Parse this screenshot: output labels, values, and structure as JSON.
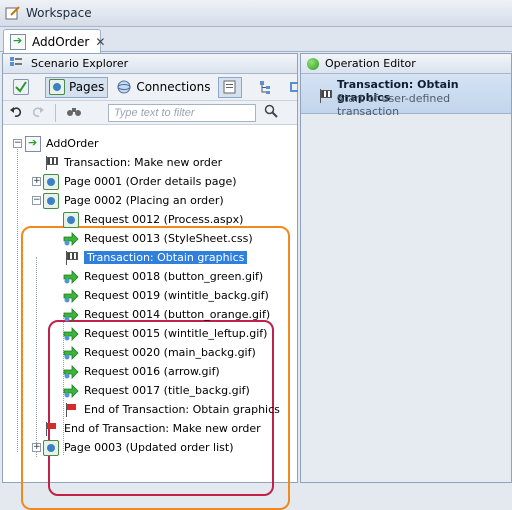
{
  "window": {
    "title": "Workspace"
  },
  "document_tab": {
    "label": "AddOrder",
    "close_glyph": "✕"
  },
  "scenario_explorer": {
    "title": "Scenario Explorer",
    "toolbar": {
      "pages_label": "Pages",
      "connections_label": "Connections"
    },
    "filter": {
      "placeholder": "Type text to filter",
      "value": ""
    }
  },
  "tree": {
    "root": "AddOrder",
    "nodes": [
      {
        "label": "Transaction: Make new order",
        "icon": "transaction-flag-icon"
      },
      {
        "label": "Page 0001 (Order details page)",
        "icon": "page-icon"
      },
      {
        "label": "Page 0002 (Placing an order)",
        "icon": "page-icon"
      },
      {
        "label": "Request 0012 (Process.aspx)",
        "icon": "request-page-icon"
      },
      {
        "label": "Request 0013 (StyleSheet.css)",
        "icon": "request-arrow-icon"
      },
      {
        "label": "Transaction: Obtain graphics",
        "icon": "transaction-flag-icon",
        "selected": true
      },
      {
        "label": "Request 0018 (button_green.gif)",
        "icon": "request-arrow-icon"
      },
      {
        "label": "Request 0019 (wintitle_backg.gif)",
        "icon": "request-arrow-icon"
      },
      {
        "label": "Request 0014 (button_orange.gif)",
        "icon": "request-arrow-icon"
      },
      {
        "label": "Request 0015 (wintitle_leftup.gif)",
        "icon": "request-arrow-icon"
      },
      {
        "label": "Request 0020 (main_backg.gif)",
        "icon": "request-arrow-icon"
      },
      {
        "label": "Request 0016 (arrow.gif)",
        "icon": "request-arrow-icon"
      },
      {
        "label": "Request 0017 (title_backg.gif)",
        "icon": "request-arrow-icon"
      },
      {
        "label": "End of Transaction: Obtain graphics",
        "icon": "end-transaction-flag-icon"
      },
      {
        "label": "End of Transaction: Make new order",
        "icon": "end-transaction-flag-icon"
      },
      {
        "label": "Page 0003 (Updated order list)",
        "icon": "page-icon"
      }
    ]
  },
  "operation_editor": {
    "title": "Operation Editor",
    "item_title": "Transaction: Obtain graphics",
    "item_subtitle": "Start of user-defined transaction"
  },
  "colors": {
    "selection": "#2f7fdc",
    "outer_highlight": "#f08a1c",
    "inner_highlight": "#c0204a",
    "end_flag": "#d62b2b"
  }
}
